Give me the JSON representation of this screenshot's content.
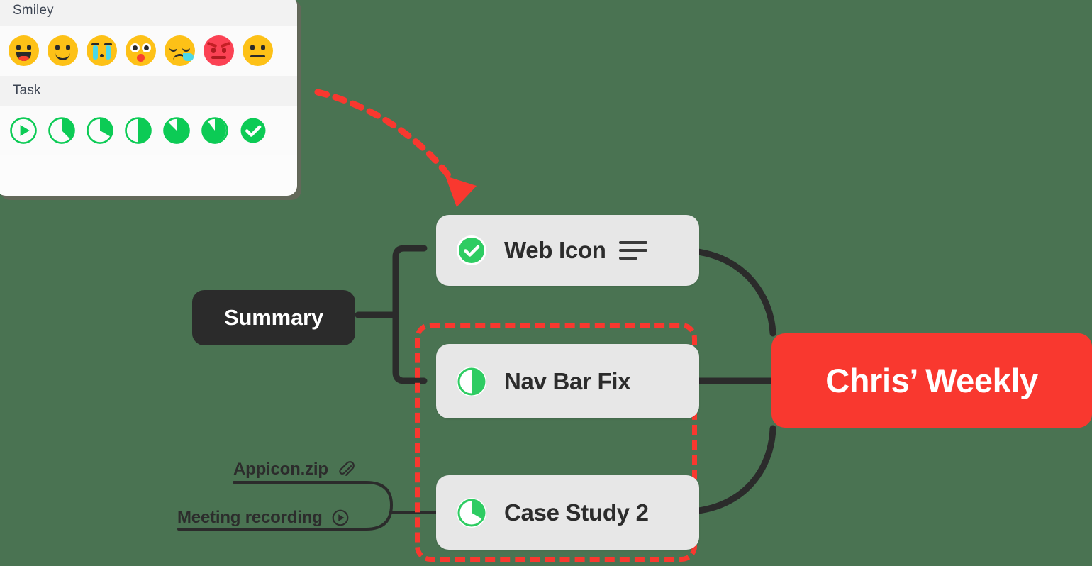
{
  "canvas": {
    "background_color": "#4A7352"
  },
  "icon_picker": {
    "sections": [
      {
        "title": "Smiley",
        "items": [
          {
            "name": "grinning-emoji",
            "color": "#FDC117"
          },
          {
            "name": "slightly-smiling-emoji",
            "color": "#FDC117"
          },
          {
            "name": "crying-emoji",
            "color": "#FDC117"
          },
          {
            "name": "astonished-emoji",
            "color": "#FDC117"
          },
          {
            "name": "sleepy-tear-emoji",
            "color": "#FDC117"
          },
          {
            "name": "angry-emoji",
            "color": "#FB4254"
          },
          {
            "name": "neutral-emoji",
            "color": "#FDC117"
          }
        ]
      },
      {
        "title": "Task",
        "items": [
          {
            "name": "task-start-icon",
            "progress": 0,
            "color": "#0CCB55"
          },
          {
            "name": "task-progress-12-icon",
            "progress": 12,
            "color": "#0CCB55"
          },
          {
            "name": "task-progress-25-icon",
            "progress": 25,
            "color": "#0CCB55"
          },
          {
            "name": "task-progress-50-icon",
            "progress": 50,
            "color": "#0CCB55"
          },
          {
            "name": "task-progress-62-icon",
            "progress": 62,
            "color": "#0CCB55"
          },
          {
            "name": "task-progress-87-icon",
            "progress": 87,
            "color": "#0CCB55"
          },
          {
            "name": "task-complete-icon",
            "progress": 100,
            "color": "#0CCB55"
          }
        ]
      }
    ]
  },
  "mindmap": {
    "root": {
      "label": "Chris’ Weekly",
      "color": "#F9382F",
      "text_color": "#FFFFFF"
    },
    "group_label": {
      "label": "Summary",
      "color": "#2B2B2B",
      "text_color": "#FFFFFF"
    },
    "cards": [
      {
        "id": "web",
        "label": "Web Icon",
        "status_icon": "task-complete-icon",
        "progress": 100,
        "has_note": true,
        "note_icon": "note-lines-icon"
      },
      {
        "id": "nav",
        "label": "Nav Bar Fix",
        "status_icon": "task-progress-50-icon",
        "progress": 50,
        "has_note": false
      },
      {
        "id": "case",
        "label": "Case Study 2",
        "status_icon": "task-progress-25-icon",
        "progress": 25,
        "has_note": false
      }
    ],
    "attachments": [
      {
        "label": "Appicon.zip",
        "icon": "paperclip-icon"
      },
      {
        "label": "Meeting recording",
        "icon": "play-circle-icon"
      }
    ],
    "selection": {
      "style": "dashed",
      "color": "#F9382F"
    },
    "pointer_arrow": {
      "name": "dashed-curved-arrow",
      "color": "#F9382F"
    }
  }
}
